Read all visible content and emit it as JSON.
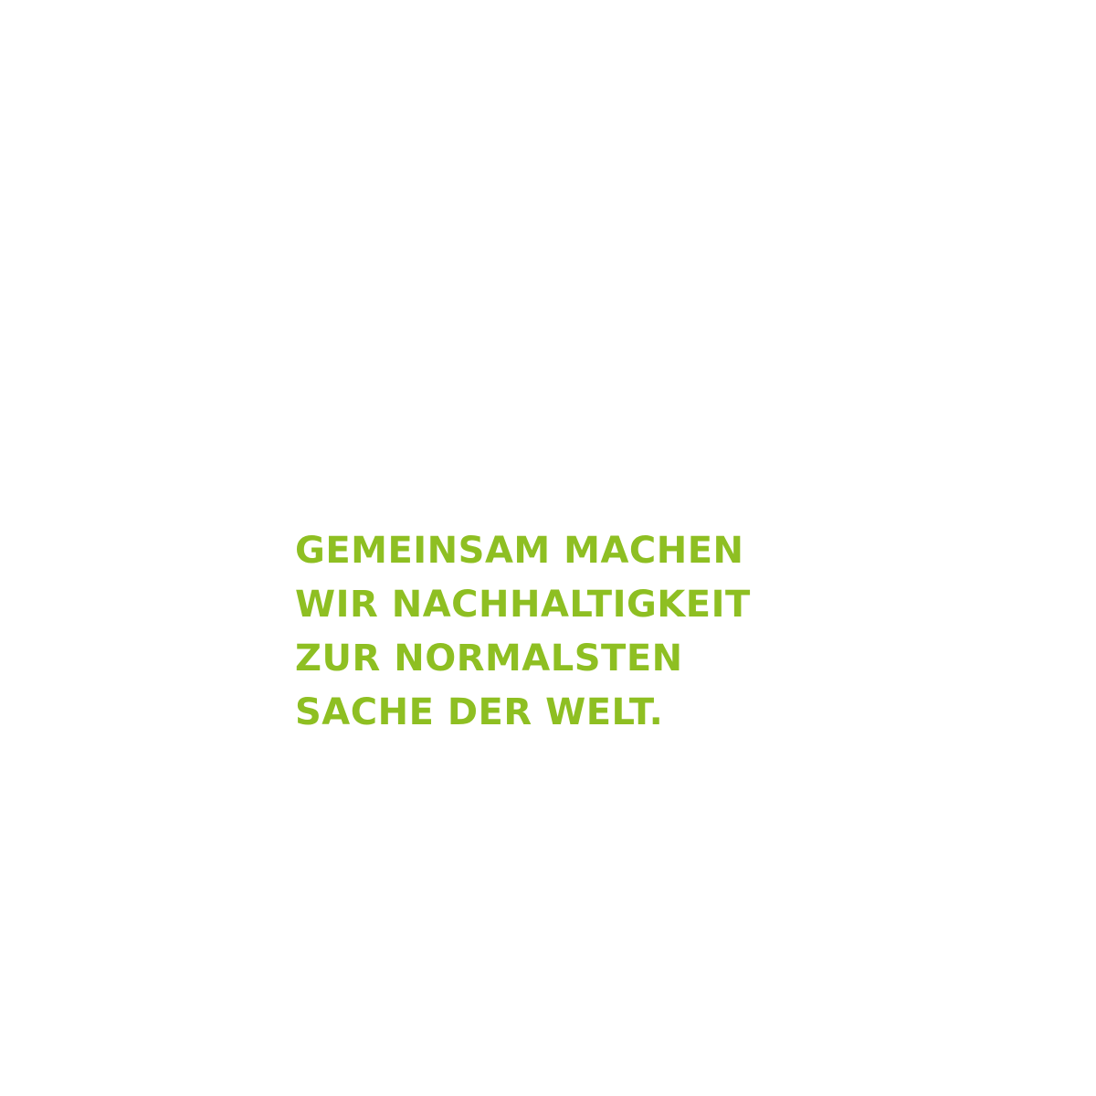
{
  "colors": {
    "background": "#ffffff",
    "accent_green": "#8ebf22"
  },
  "slogan": {
    "lines": [
      "GEMEINSAM MACHEN",
      "WIR NACHHALTIGKEIT",
      "ZUR NORMALSTEN",
      "SACHE DER WELT."
    ]
  }
}
